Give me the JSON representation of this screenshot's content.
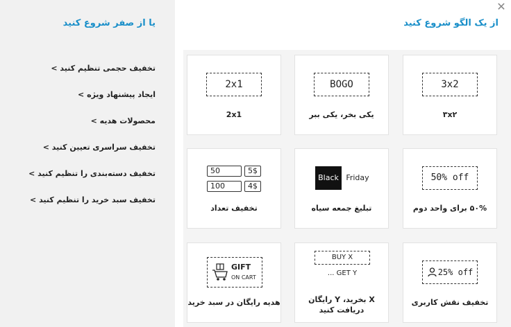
{
  "sidebar": {
    "title": "یا از صفر شروع کنید",
    "links": [
      "تخفیف حجمی تنظیم کنید >",
      "ایجاد پیشنهاد ویژه >",
      "محصولات هدیه >",
      "تخفیف سراسری تعیین کنید >",
      "تخفیف دسته‌بندی را تنظیم کنید >",
      "تخفیف سبد خرید را تنظیم کنید >"
    ]
  },
  "main": {
    "title": "از یک الگو شروع کنید",
    "close": "✕",
    "cards": [
      {
        "label": "۳x۲",
        "badge": "3x2"
      },
      {
        "label": "یکی بخر، یکی ببر",
        "badge": "BOGO"
      },
      {
        "label": "2x1",
        "badge": "2x1"
      },
      {
        "label": "۵۰% برای واحد دوم",
        "badge": "50% off"
      },
      {
        "label": "تبلیغ جمعه سیاه",
        "badge_black": "Black",
        "badge_friday": "Friday"
      },
      {
        "label": "تخفیف تعداد",
        "qty": [
          "50",
          "100"
        ],
        "price": [
          "5$",
          "4$"
        ]
      },
      {
        "label": "تخفیف نقش کاربری",
        "badge": "25% off"
      },
      {
        "label": "X بخرید، Y رایگان دریافت کنید",
        "buy": "BUY X",
        "get": "... GET Y"
      },
      {
        "label": "هدیه رایگان در سبد خرید",
        "gift": "GIFT",
        "oncart": "ON CART"
      }
    ]
  }
}
